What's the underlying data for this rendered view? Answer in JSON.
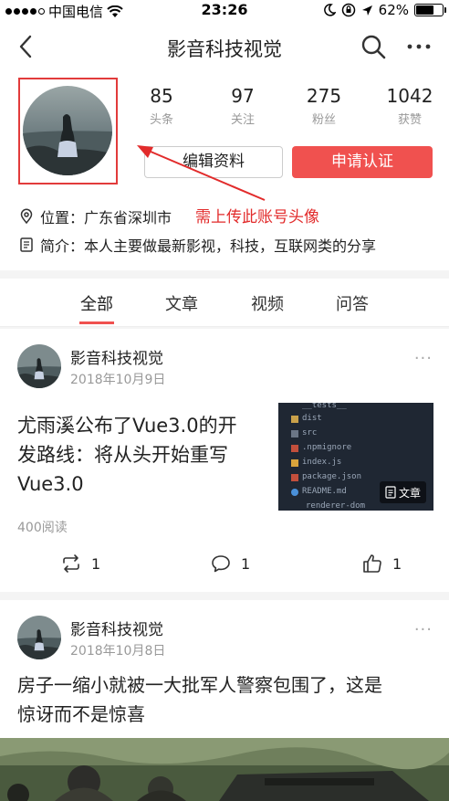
{
  "status_bar": {
    "carrier": "中国电信",
    "time": "23:26",
    "battery_text": "62%",
    "battery_level": 0.62,
    "icons": [
      "signal-dots-icon",
      "wifi-icon",
      "moon-icon",
      "orientation-lock-icon",
      "location-arrow-icon",
      "battery-icon"
    ]
  },
  "nav": {
    "title": "影音科技视觉",
    "icons": [
      "back-chevron-icon",
      "search-icon",
      "more-dots-icon"
    ]
  },
  "profile": {
    "stats": [
      {
        "value": "85",
        "label": "头条"
      },
      {
        "value": "97",
        "label": "关注"
      },
      {
        "value": "275",
        "label": "粉丝"
      },
      {
        "value": "1042",
        "label": "获赞"
      }
    ],
    "edit_label": "编辑资料",
    "apply_label": "申请认证",
    "annotation": "需上传此账号头像",
    "location_label": "位置：",
    "location_value": "广东省深圳市",
    "bio_label": "简介：",
    "bio_value": "本人主要做最新影视，科技，互联网类的分享",
    "annotation_color": "#e22b2b",
    "accent_color": "#f0514f"
  },
  "tabs": [
    {
      "label": "全部",
      "active": true
    },
    {
      "label": "文章",
      "active": false
    },
    {
      "label": "视频",
      "active": false
    },
    {
      "label": "问答",
      "active": false
    }
  ],
  "posts": [
    {
      "author": "影音科技视觉",
      "date": "2018年10月9日",
      "more": "···",
      "headline_lines": [
        "尤雨溪公布了Vue3.0的开",
        "发路线：将从头开始重写",
        "Vue3.0"
      ],
      "thumb_files": [
        "__tests__",
        "dist",
        "src",
        ".npmignore",
        "index.js",
        "package.json",
        "README.md",
        "renderer-dom"
      ],
      "thumb_badge": "文章",
      "reads": "400阅读",
      "repost_count": "1",
      "comment_count": "1",
      "like_count": "1"
    },
    {
      "author": "影音科技视觉",
      "date": "2018年10月8日",
      "more": "···",
      "headline_lines": [
        "房子一缩小就被一大批军人警察包围了，这是",
        "惊讶而不是惊喜"
      ]
    }
  ]
}
